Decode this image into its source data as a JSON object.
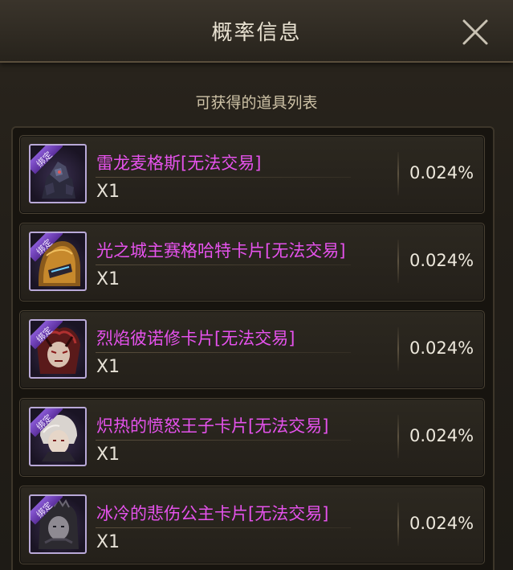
{
  "dialog": {
    "title": "概率信息",
    "subtitle": "可获得的道具列表"
  },
  "items": [
    {
      "name": "雷龙麦格斯[无法交易]",
      "qty": "X1",
      "prob": "0.024%",
      "tag": "绑定",
      "icon": "dragon-armor-icon"
    },
    {
      "name": "光之城主赛格哈特卡片[无法交易]",
      "qty": "X1",
      "prob": "0.024%",
      "tag": "绑定",
      "icon": "golden-helmet-icon"
    },
    {
      "name": "烈焰彼诺修卡片[无法交易]",
      "qty": "X1",
      "prob": "0.024%",
      "tag": "绑定",
      "icon": "flame-demon-icon"
    },
    {
      "name": "炽热的愤怒王子卡片[无法交易]",
      "qty": "X1",
      "prob": "0.024%",
      "tag": "绑定",
      "icon": "white-hair-prince-icon"
    },
    {
      "name": "冰冷的悲伤公主卡片[无法交易]",
      "qty": "X1",
      "prob": "0.024%",
      "tag": "绑定",
      "icon": "dark-princess-icon"
    }
  ],
  "colors": {
    "item_name": "#e552ec",
    "icon_border": "#b9a9d8",
    "bind_tag": "#6b3fb2"
  }
}
